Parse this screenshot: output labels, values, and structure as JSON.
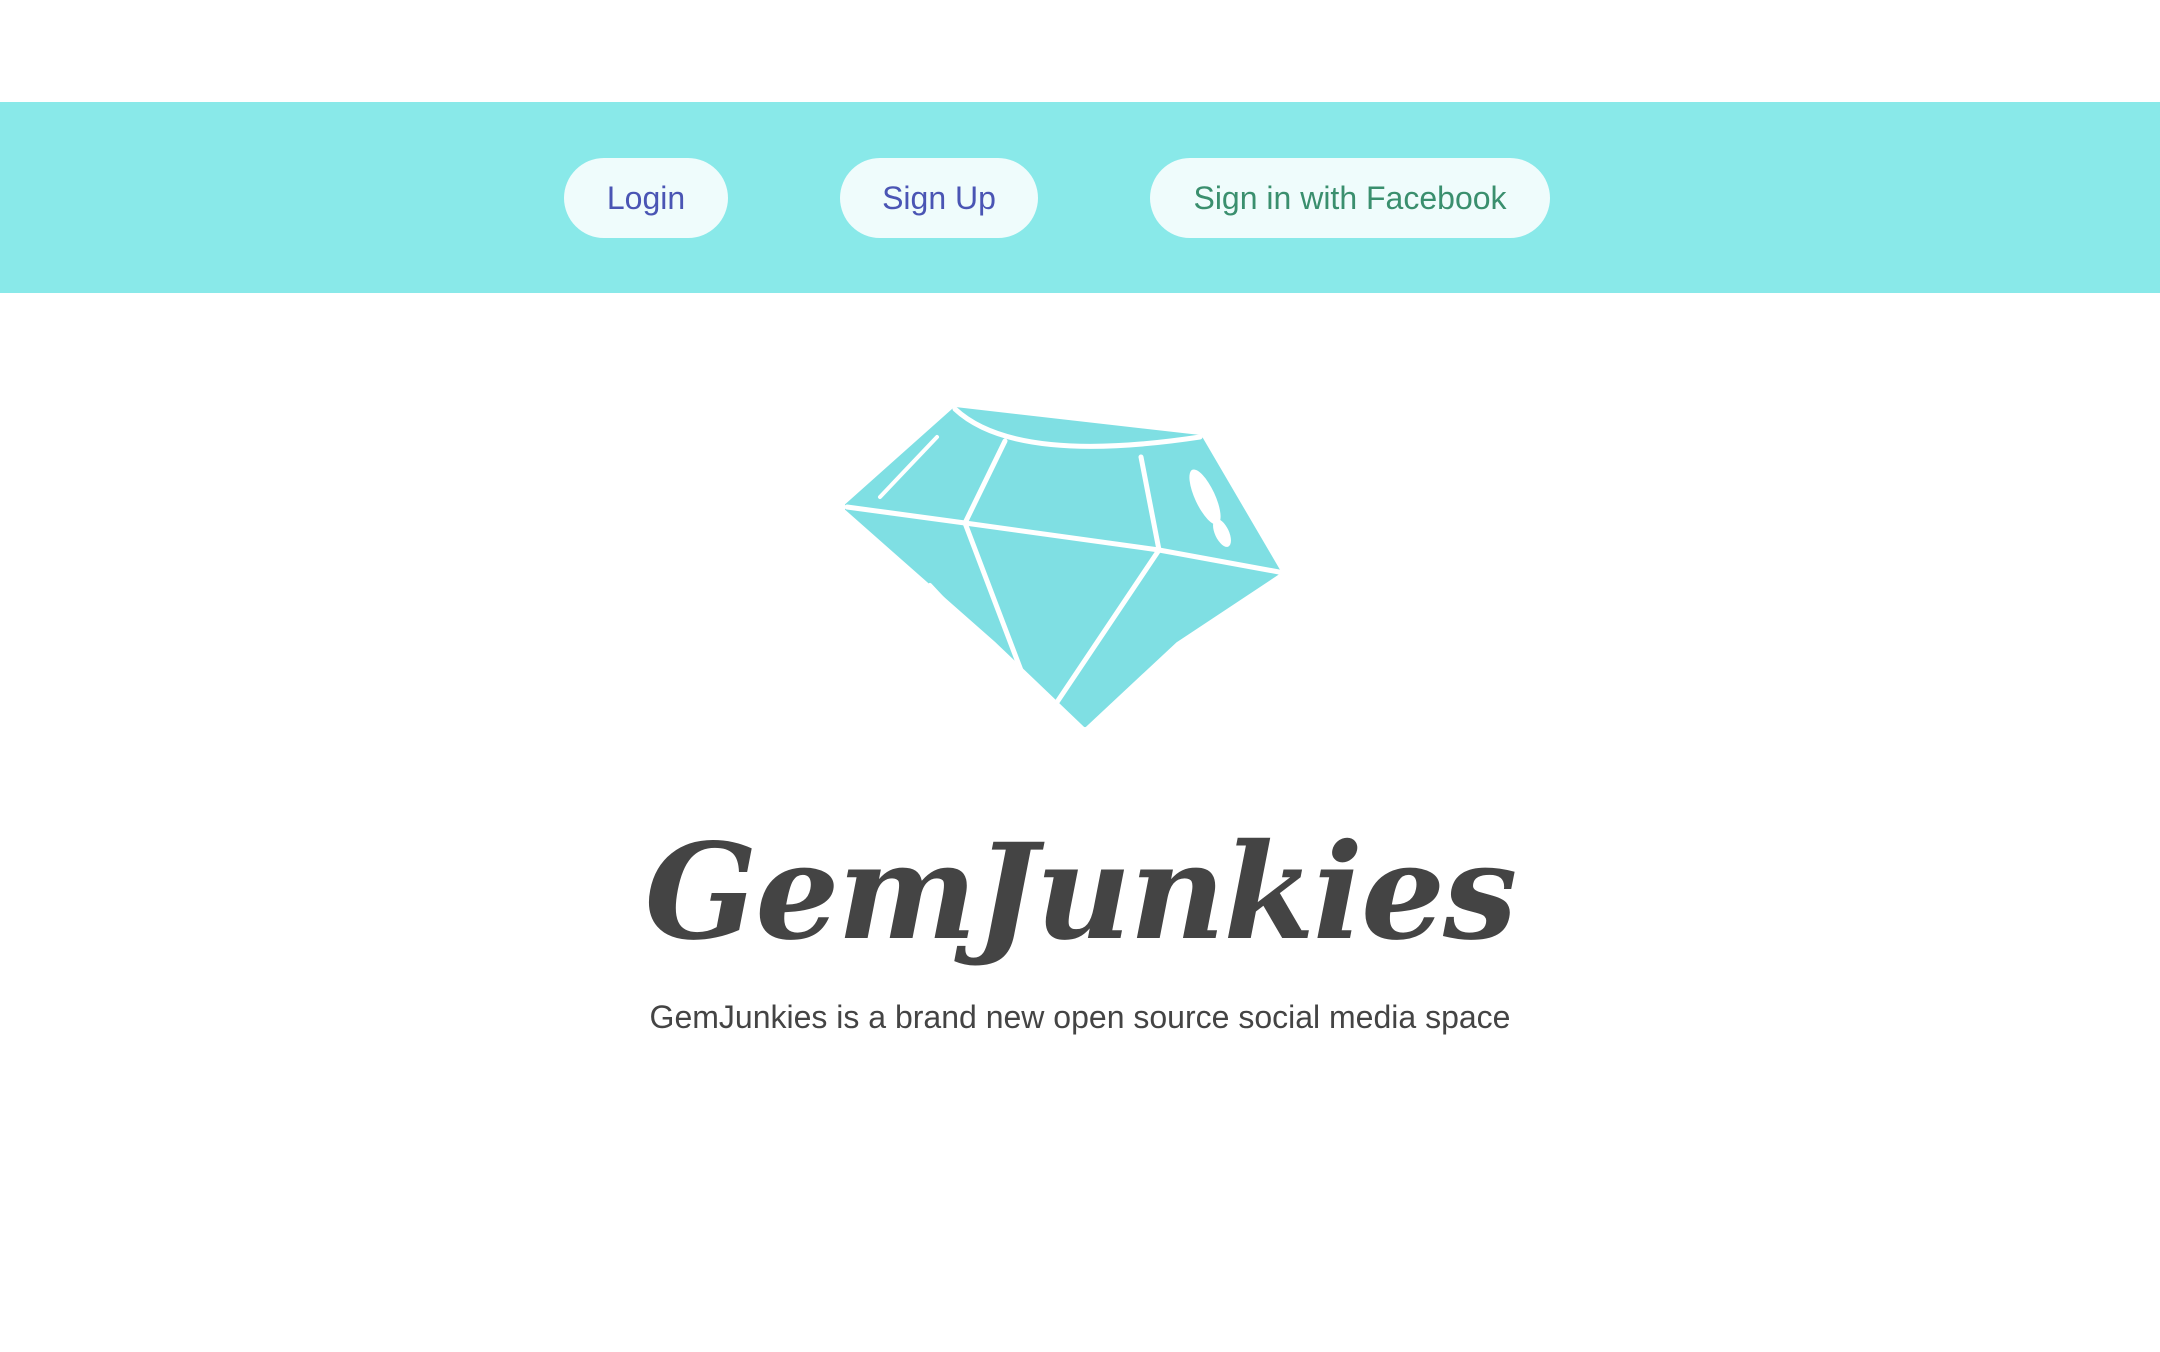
{
  "nav": {
    "login_label": "Login",
    "signup_label": "Sign Up",
    "facebook_label": "Sign in with Facebook"
  },
  "hero": {
    "logo_icon": "diamond-icon",
    "title": "GemJunkies",
    "tagline": "GemJunkies is a brand new open source social media space"
  },
  "colors": {
    "navbar_bg": "#89e9e9",
    "button_bg": "#effcfc",
    "button_text": "#4a55b4",
    "facebook_text": "#3a8f6e",
    "gem_fill": "#7fdfe3",
    "text_dark": "#444444"
  }
}
